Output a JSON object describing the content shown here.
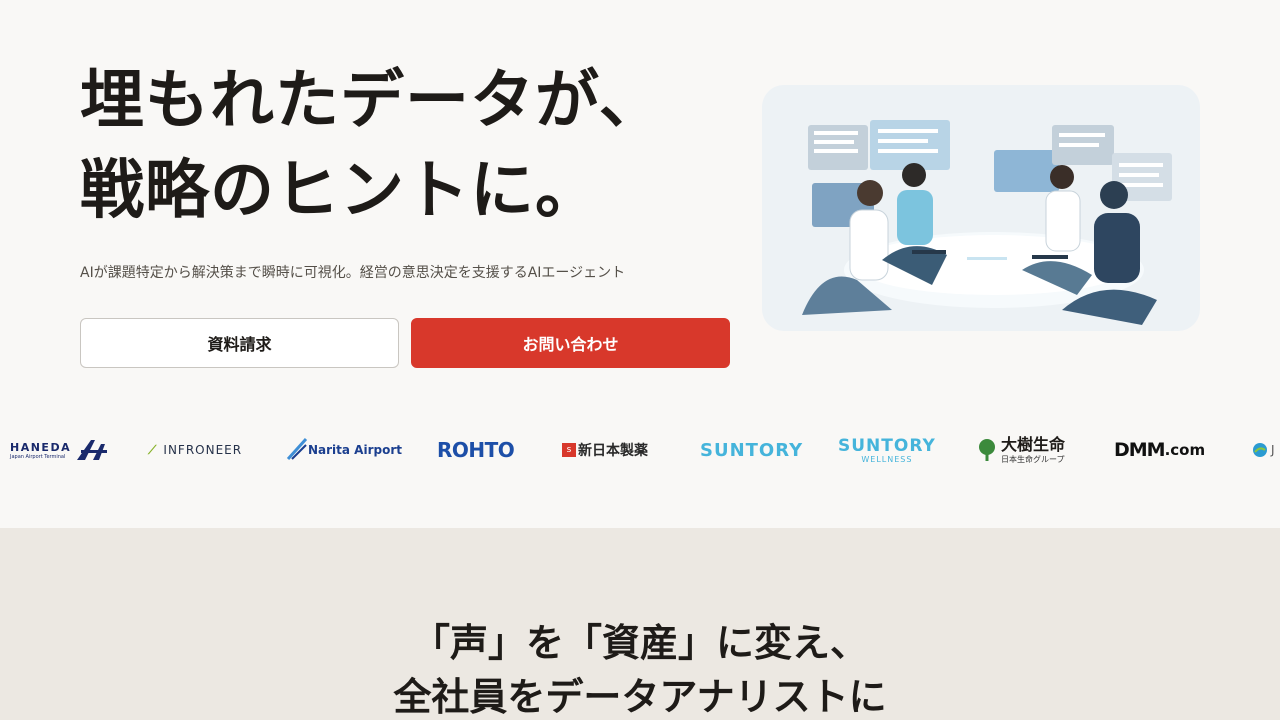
{
  "hero": {
    "headline_line1": "埋もれたデータが、",
    "headline_line2": "戦略のヒントに。",
    "subtext": "AIが課題特定から解決策まで瞬時に可視化。経営の意思決定を支援するAIエージェント",
    "btn_documents": "資料請求",
    "btn_contact": "お問い合わせ",
    "accent_color": "#d8382b"
  },
  "illustration": {
    "icon": "business-meeting-illustration"
  },
  "logos": {
    "haneda_main": "HANEDA",
    "haneda_sub": "Japan Airport Terminal",
    "infroneer": "INFRONEER",
    "narita": "Narita Airport",
    "rohto": "ROHTO",
    "shinnihon": "新日本製薬",
    "suntory": "SUNTORY",
    "suntory_wellness_main": "SUNTORY",
    "suntory_wellness_sub": "WELLNESS",
    "taiju_main": "大樹生命",
    "taiju_sub": "日本生命グループ",
    "dmm_main": "DMM",
    "dmm_suffix": ".com",
    "partial": "J"
  },
  "section2": {
    "heading_line1": "「声」を「資産」に変え、",
    "heading_line2": "全社員をデータアナリストに",
    "background": "#ece8e2"
  }
}
